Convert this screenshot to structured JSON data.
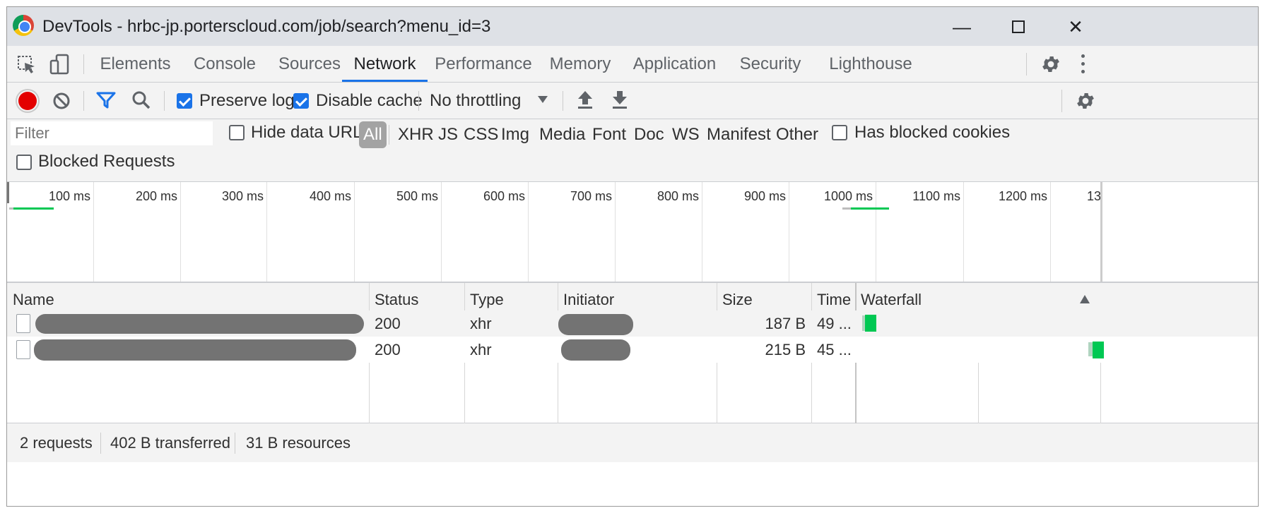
{
  "window": {
    "title": "DevTools - hrbc-jp.porterscloud.com/job/search?menu_id=3"
  },
  "tabs": [
    {
      "label": "Elements",
      "active": false
    },
    {
      "label": "Console",
      "active": false
    },
    {
      "label": "Sources",
      "active": false
    },
    {
      "label": "Network",
      "active": true
    },
    {
      "label": "Performance",
      "active": false
    },
    {
      "label": "Memory",
      "active": false
    },
    {
      "label": "Application",
      "active": false
    },
    {
      "label": "Security",
      "active": false
    },
    {
      "label": "Lighthouse",
      "active": false
    }
  ],
  "toolbar": {
    "preserve_log": {
      "label": "Preserve log",
      "checked": true
    },
    "disable_cache": {
      "label": "Disable cache",
      "checked": true
    },
    "throttling": "No throttling"
  },
  "filter": {
    "placeholder": "Filter",
    "hide_data_urls": {
      "label": "Hide data URLs",
      "checked": false
    },
    "types": [
      "All",
      "XHR",
      "JS",
      "CSS",
      "Img",
      "Media",
      "Font",
      "Doc",
      "WS",
      "Manifest",
      "Other"
    ],
    "active_type": "All",
    "has_blocked_cookies": {
      "label": "Has blocked cookies",
      "checked": false
    },
    "blocked_requests": {
      "label": "Blocked Requests",
      "checked": false
    }
  },
  "overview": {
    "ticks": [
      "100 ms",
      "200 ms",
      "300 ms",
      "400 ms",
      "500 ms",
      "600 ms",
      "700 ms",
      "800 ms",
      "900 ms",
      "1000 ms",
      "1100 ms",
      "1200 ms",
      "13"
    ]
  },
  "table": {
    "columns": [
      "Name",
      "Status",
      "Type",
      "Initiator",
      "Size",
      "Time",
      "Waterfall"
    ],
    "rows": [
      {
        "status": "200",
        "type": "xhr",
        "size": "187 B",
        "time": "49 ..."
      },
      {
        "status": "200",
        "type": "xhr",
        "size": "215 B",
        "time": "45 ..."
      }
    ]
  },
  "status": {
    "requests": "2 requests",
    "transferred": "402 B transferred",
    "resources": "31 B resources"
  },
  "colors": {
    "accent": "#1a73e8",
    "record": "#e30000",
    "waterfall": "#00c853"
  }
}
